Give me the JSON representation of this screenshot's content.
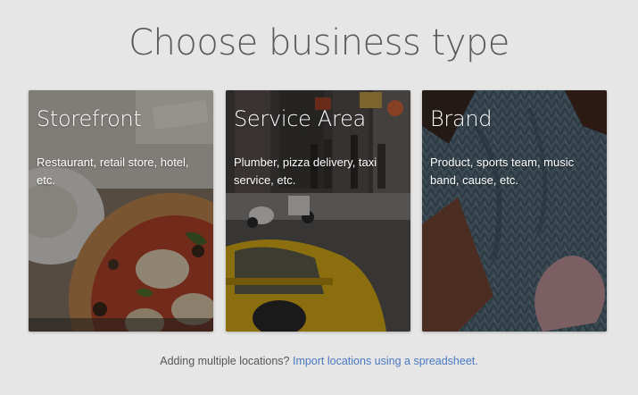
{
  "page": {
    "title": "Choose business type"
  },
  "cards": [
    {
      "title": "Storefront",
      "description": "Restaurant, retail store, hotel, etc."
    },
    {
      "title": "Service Area",
      "description": "Plumber, pizza delivery, taxi service, etc."
    },
    {
      "title": "Brand",
      "description": "Product, sports team, music band, cause, etc."
    }
  ],
  "footer": {
    "text": "Adding multiple locations?",
    "link_text": "Import locations using a spreadsheet."
  },
  "colors": {
    "background": "#e6e6e6",
    "title_text": "#5a5a5a",
    "link": "#4a78c2"
  }
}
